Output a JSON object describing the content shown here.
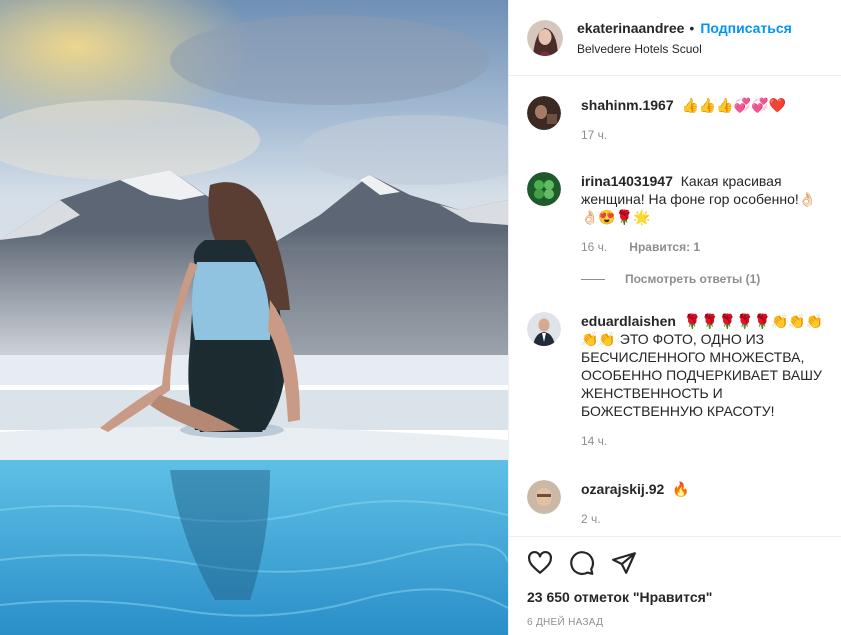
{
  "post": {
    "author": "ekaterinaandree",
    "separator": "•",
    "follow_label": "Подписаться",
    "location": "Belvedere Hotels Scuol"
  },
  "comments": [
    {
      "username": "shahinm.1967",
      "text": "👍👍👍💞💞❤️",
      "time": "17 ч."
    },
    {
      "username": "irina14031947",
      "text": "Какая красивая женщина! На фоне гор особенно!👌🏻👌🏻😍🌹🌟",
      "time": "16 ч.",
      "likes": "Нравится: 1",
      "replies": "Посмотреть ответы (1)"
    },
    {
      "username": "eduardlaishen",
      "text": "🌹🌹🌹🌹🌹👏👏👏👏👏 ЭТО ФОТО, ОДНО ИЗ БЕСЧИСЛЕННОГО МНОЖЕСТВА, ОСОБЕННО ПОДЧЕРКИВАЕТ ВАШУ ЖЕНСТВЕННОСТЬ И БОЖЕСТВЕННУЮ КРАСОТУ!",
      "time": "14 ч."
    },
    {
      "username": "ozarajskij.92",
      "text": "🔥",
      "time": "2 ч."
    }
  ],
  "actions": {
    "like_icon": "heart-icon",
    "comment_icon": "comment-icon",
    "share_icon": "paper-plane-icon"
  },
  "likes_text": "23 650 отметок \"Нравится\"",
  "date_text": "6 ДНЕЙ НАЗАД",
  "colors": {
    "accent": "#0095f6",
    "muted": "#8e8e8e",
    "text": "#262626",
    "divider": "#efefef"
  }
}
